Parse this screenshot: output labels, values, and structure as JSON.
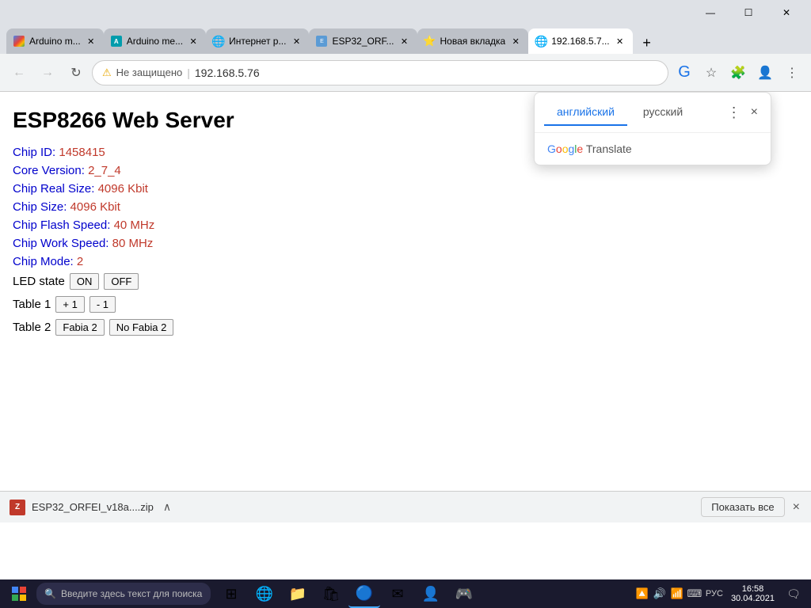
{
  "browser": {
    "tabs": [
      {
        "id": "tab-gmail",
        "favicon_type": "gmail",
        "title": "Arduino m...",
        "active": false,
        "closeable": true
      },
      {
        "id": "tab-arduino1",
        "favicon_type": "arduino",
        "title": "Arduino me...",
        "active": false,
        "closeable": true
      },
      {
        "id": "tab-internet",
        "favicon_type": "earth",
        "title": "Интернет р...",
        "active": false,
        "closeable": true
      },
      {
        "id": "tab-esp32",
        "favicon_type": "esp",
        "title": "ESP32_ORF...",
        "active": false,
        "closeable": true
      },
      {
        "id": "tab-newtab",
        "favicon_type": "newtab",
        "title": "Новая вкладка",
        "active": false,
        "closeable": true
      },
      {
        "id": "tab-active",
        "favicon_type": "active",
        "title": "192.168.5.7...",
        "active": true,
        "closeable": true
      }
    ],
    "new_tab_btn": "+",
    "address_bar": {
      "security_label": "Не защищено",
      "url": "192.168.5.76"
    },
    "nav": {
      "back": "←",
      "forward": "→",
      "refresh": "↻"
    }
  },
  "webpage": {
    "title": "ESP8266 Web Server",
    "info_lines": [
      {
        "label": "Chip ID:",
        "value": "1458415"
      },
      {
        "label": "Core Version:",
        "value": "2_7_4"
      },
      {
        "label": "Chip Real Size:",
        "value": "4096 Kbit"
      },
      {
        "label": "Chip Size:",
        "value": "4096 Kbit"
      },
      {
        "label": "Chip Flash Speed:",
        "value": "40 MHz"
      },
      {
        "label": "Chip Work Speed:",
        "value": "80 MHz"
      },
      {
        "label": "Chip Mode:",
        "value": "2"
      }
    ],
    "led_state_label": "LED state",
    "led_on_btn": "ON",
    "led_off_btn": "OFF",
    "table1_label": "Table 1",
    "table1_plus_btn": "+ 1",
    "table1_minus_btn": "- 1",
    "table2_label": "Table 2",
    "table2_yes_btn": "Fabia 2",
    "table2_no_btn": "No Fabia 2"
  },
  "translate_popup": {
    "tab_english": "английский",
    "tab_russian": "русский",
    "more_btn": "⋮",
    "close_btn": "×",
    "google_translate_text": "Google Translate",
    "active_tab": "english"
  },
  "download_bar": {
    "file_name": "ESP32_ORFEI_v18a....zip",
    "chevron": "∧",
    "show_all_label": "Показать все",
    "close_btn": "×"
  },
  "taskbar": {
    "search_placeholder": "Введите здесь текст для поиска",
    "lang": "РУС",
    "time": "16:58",
    "date": "30.04.2021",
    "tray_icons": [
      "🔼",
      "🔊",
      "📶",
      "⌨"
    ],
    "notification_btn": "🗨",
    "taskbar_apps": [
      {
        "name": "task-view",
        "icon": "⊞"
      },
      {
        "name": "edge-browser",
        "icon": "🌐"
      },
      {
        "name": "file-explorer",
        "icon": "📁"
      },
      {
        "name": "store",
        "icon": "🛍"
      },
      {
        "name": "chrome",
        "icon": "🔵"
      },
      {
        "name": "mail",
        "icon": "✉"
      },
      {
        "name": "people",
        "icon": "👤"
      },
      {
        "name": "steam",
        "icon": "🎮"
      }
    ]
  }
}
